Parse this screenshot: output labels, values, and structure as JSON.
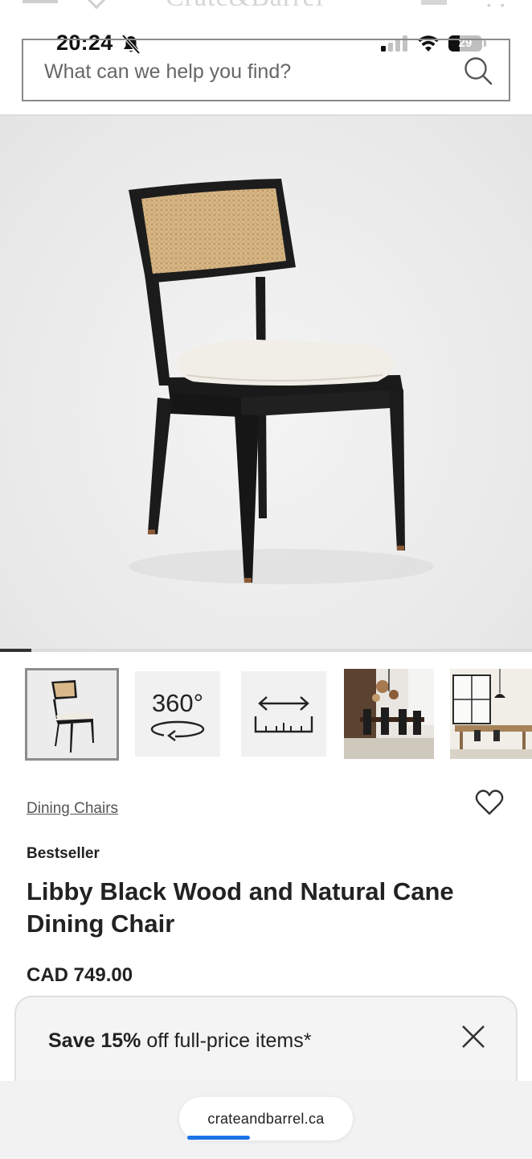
{
  "site_header": {
    "logo": "Crate&Barrel"
  },
  "status_bar": {
    "time": "20:24",
    "battery": "29"
  },
  "search": {
    "placeholder": "What can we help you find?"
  },
  "thumbnails": {
    "spin_label": "360°"
  },
  "product": {
    "breadcrumb": "Dining Chairs",
    "badge": "Bestseller",
    "title": "Libby Black Wood and Natural Cane Dining Chair",
    "price": "CAD 749.00"
  },
  "promo": {
    "strong": "Save 15%",
    "rest": " off full-price items*"
  },
  "browser": {
    "url": "crateandbarrel.ca"
  },
  "colors": {
    "accent_load": "#1a73e8",
    "text": "#222222"
  },
  "gallery": {
    "current_index": 1,
    "total": 5
  }
}
